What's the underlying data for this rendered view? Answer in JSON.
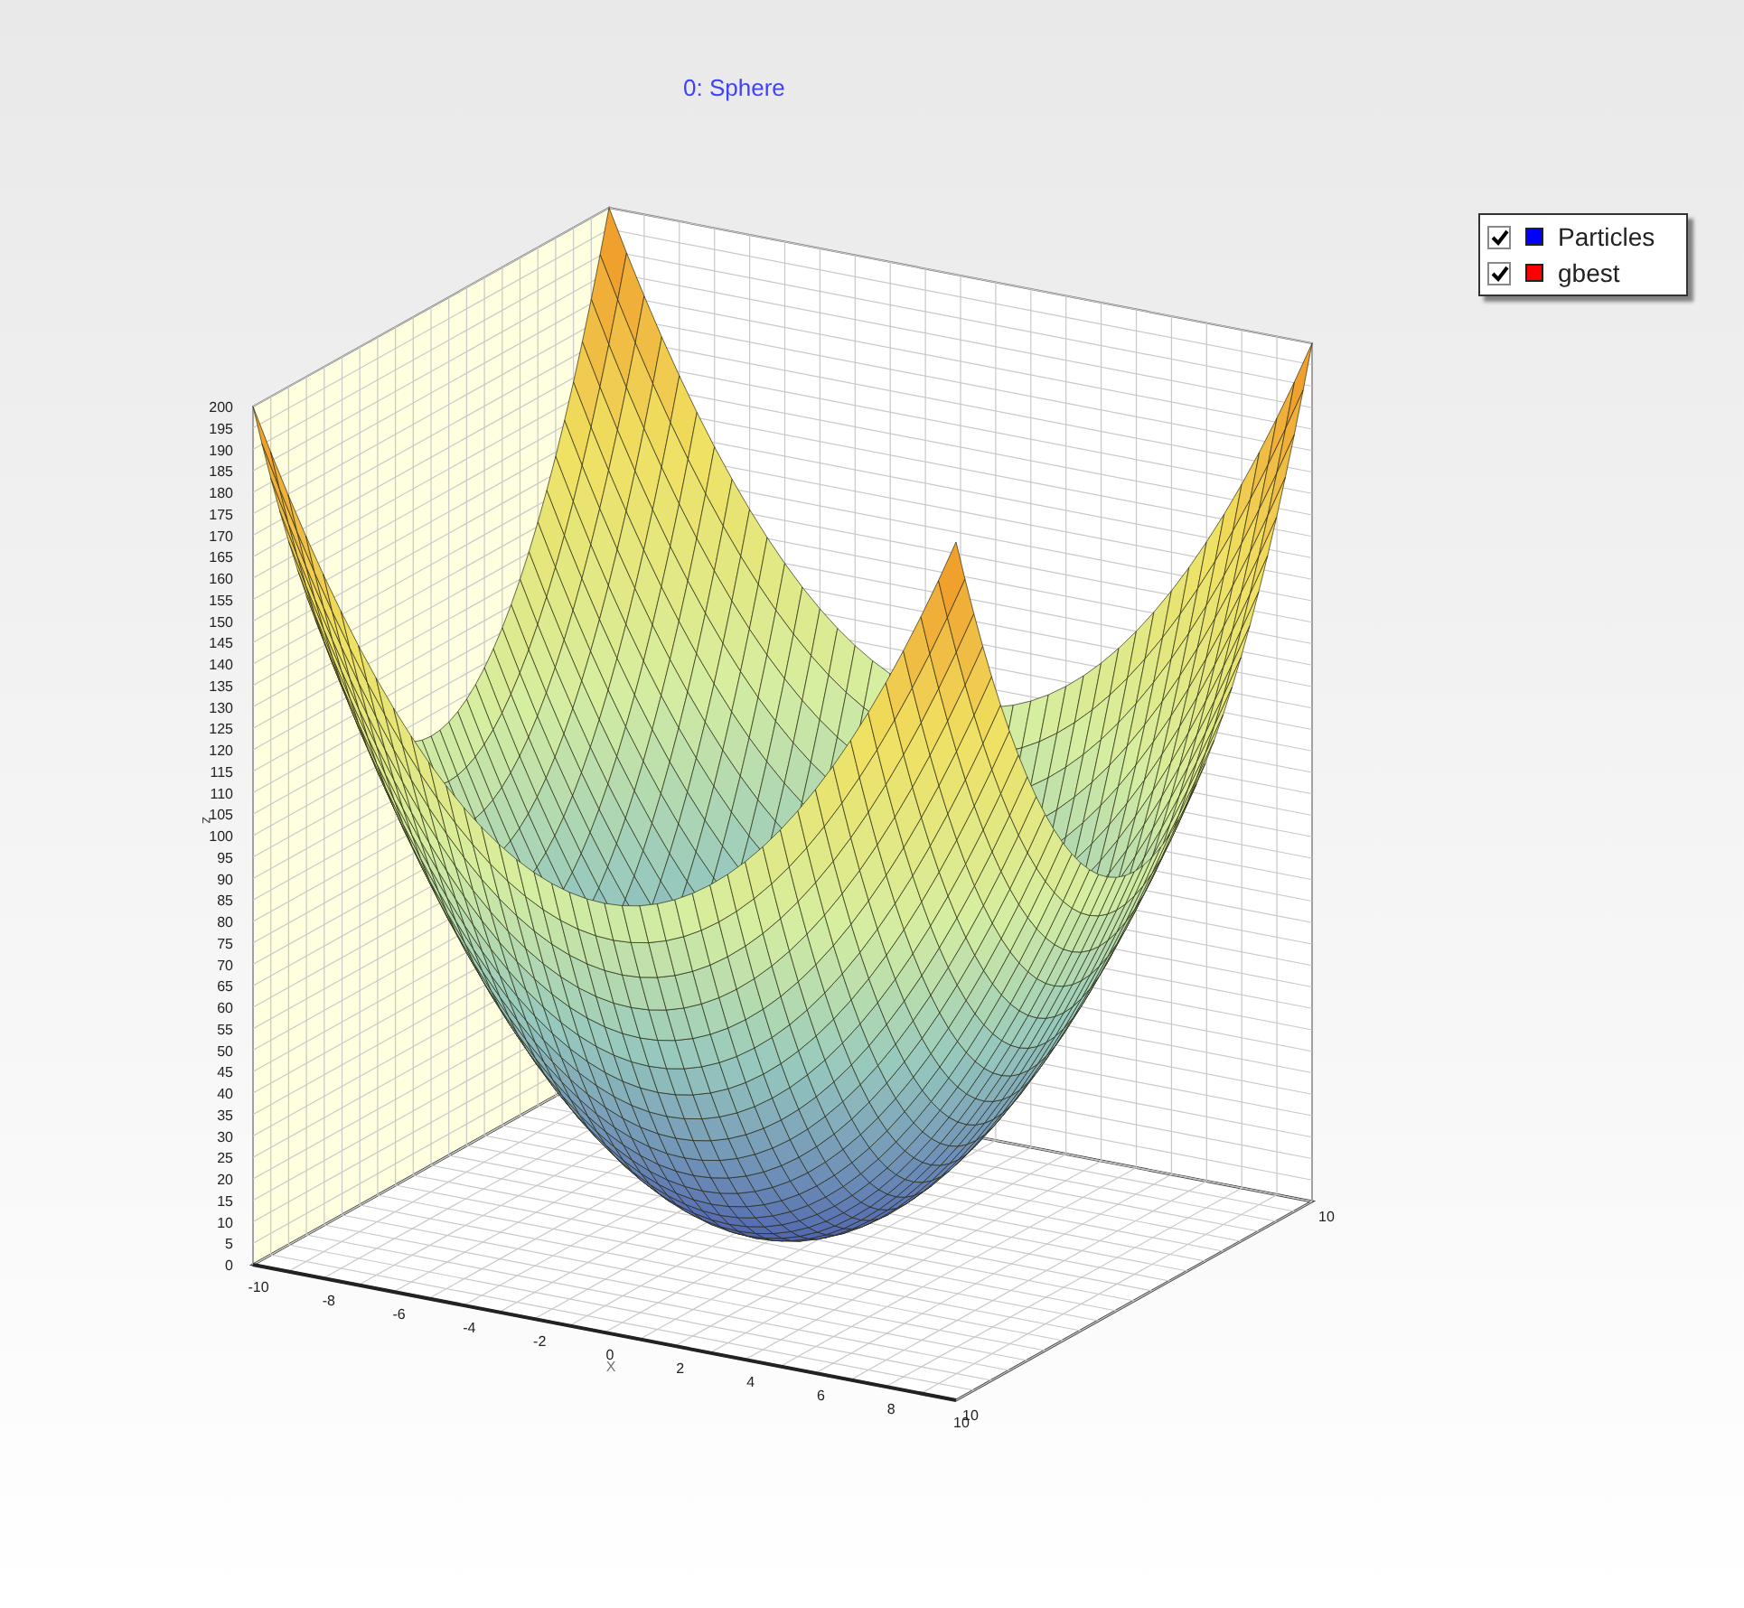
{
  "chart": {
    "title": "0: Sphere",
    "zlabel": "z",
    "xlabel": "X",
    "zticks": [
      "200",
      "195",
      "190",
      "185",
      "180",
      "175",
      "170",
      "165",
      "160",
      "155",
      "150",
      "145",
      "140",
      "135",
      "130",
      "125",
      "120",
      "115",
      "110",
      "105",
      "100",
      "95",
      "90",
      "85",
      "80",
      "75",
      "70",
      "65",
      "60",
      "55",
      "50",
      "45",
      "40",
      "35",
      "30",
      "25",
      "20",
      "15",
      "10",
      "5",
      "0"
    ],
    "xticks": [
      "-10",
      "-8",
      "-6",
      "-4",
      "-2",
      "0",
      "2",
      "4",
      "6",
      "8",
      "10"
    ],
    "yticks": [
      "10",
      "10"
    ]
  },
  "legend": [
    {
      "label": "Particles",
      "checked": true,
      "color": "#0000ff"
    },
    {
      "label": "gbest",
      "checked": true,
      "color": "#ff0000"
    }
  ]
}
